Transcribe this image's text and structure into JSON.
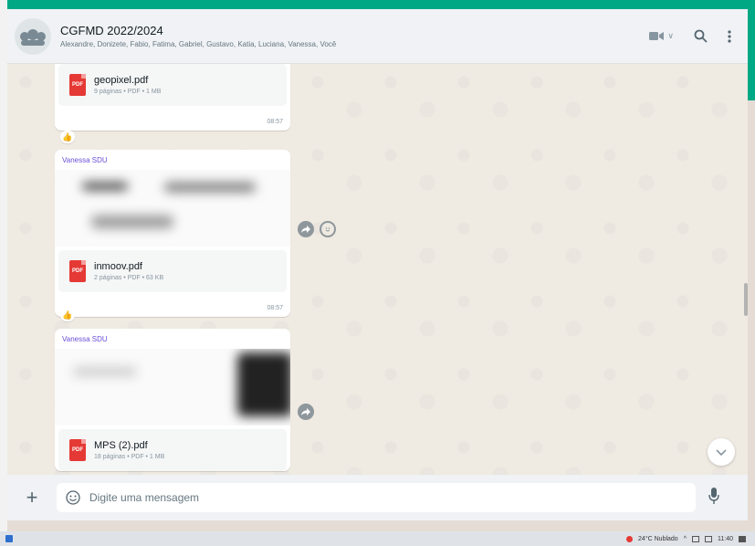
{
  "header": {
    "title": "CGFMD 2022/2024",
    "members": "Alexandre, Donizete, Fabio, Fatima, Gabriel, Gustavo, Katia, Luciana, Vanessa, Você"
  },
  "messages": [
    {
      "file_name": "geopixel.pdf",
      "file_meta": "9 páginas • PDF • 1 MB",
      "time": "08:57",
      "reaction": "👍"
    },
    {
      "sender": "Vanessa SDU",
      "file_name": "inmoov.pdf",
      "file_meta": "2 páginas • PDF • 63 KB",
      "time": "08:57",
      "reaction": "👍"
    },
    {
      "sender": "Vanessa SDU",
      "file_name": "MPS (2).pdf",
      "file_meta": "18 páginas • PDF • 1 MB"
    }
  ],
  "pdf_badge": "PDF",
  "composer": {
    "placeholder": "Digite uma mensagem"
  },
  "taskbar": {
    "weather": "24°C Nublado",
    "clock": "11:40"
  },
  "colors": {
    "accent": "#00a884",
    "sender": "#6b4fd8",
    "pdf": "#e53935"
  }
}
